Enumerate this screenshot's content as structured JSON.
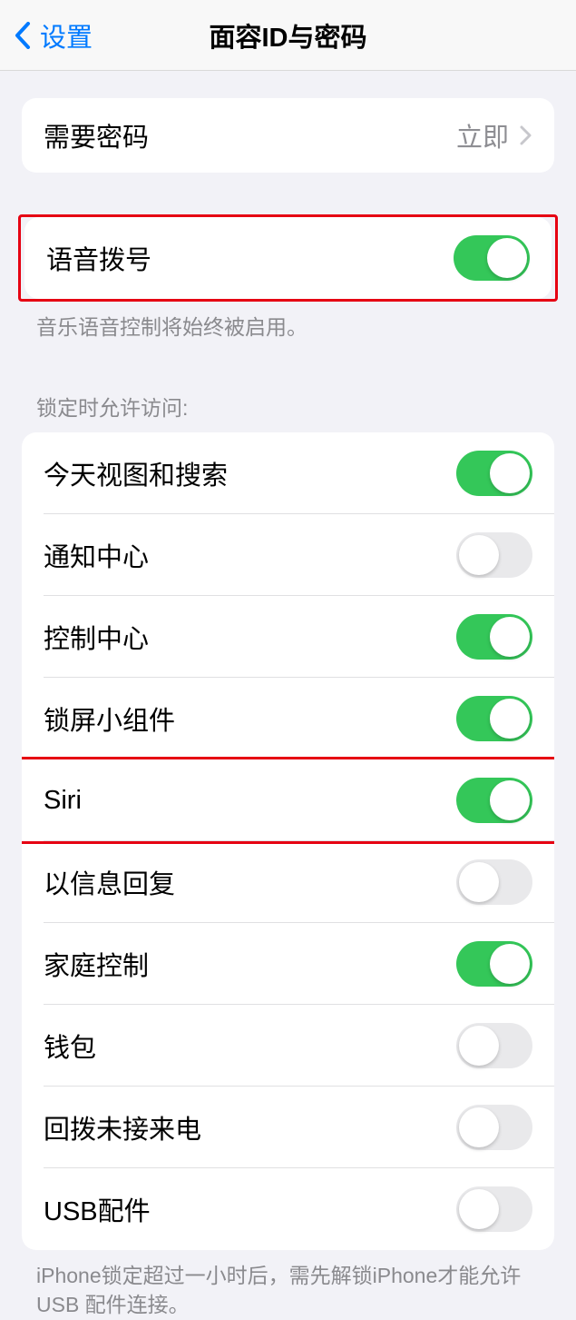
{
  "nav": {
    "back_label": "设置",
    "title": "面容ID与密码"
  },
  "require_passcode": {
    "label": "需要密码",
    "value": "立即"
  },
  "voice_dial": {
    "label": "语音拨号",
    "footer": "音乐语音控制将始终被启用。"
  },
  "lock_access": {
    "header": "锁定时允许访问:",
    "items": [
      {
        "label": "今天视图和搜索",
        "on": true
      },
      {
        "label": "通知中心",
        "on": false
      },
      {
        "label": "控制中心",
        "on": true
      },
      {
        "label": "锁屏小组件",
        "on": true
      },
      {
        "label": "Siri",
        "on": true
      },
      {
        "label": "以信息回复",
        "on": false
      },
      {
        "label": "家庭控制",
        "on": true
      },
      {
        "label": "钱包",
        "on": false
      },
      {
        "label": "回拨未接来电",
        "on": false
      },
      {
        "label": "USB配件",
        "on": false
      }
    ],
    "footer": "iPhone锁定超过一小时后，需先解锁iPhone才能允许USB 配件连接。"
  }
}
